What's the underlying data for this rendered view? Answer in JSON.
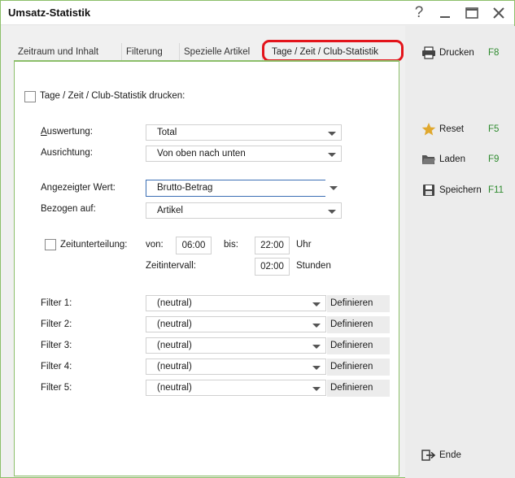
{
  "window": {
    "title": "Umsatz-Statistik"
  },
  "titlebar_buttons": {
    "help": "?"
  },
  "tabs": [
    {
      "label": "Zeitraum und Inhalt"
    },
    {
      "label": "Filterung"
    },
    {
      "label": "Spezielle Artikel"
    },
    {
      "label": "Tage / Zeit / Club-Statistik"
    }
  ],
  "form": {
    "print_checkbox_label": "Tage / Zeit / Club-Statistik drucken:",
    "auswertung": {
      "label": "Auswertung:",
      "value": "Total"
    },
    "ausrichtung": {
      "label": "Ausrichtung:",
      "value": "Von oben nach unten"
    },
    "angezeigter_wert": {
      "label": "Angezeigter Wert:",
      "value": "Brutto-Betrag"
    },
    "bezogen_auf": {
      "label": "Bezogen auf:",
      "value": "Artikel"
    },
    "zeitunterteilung": {
      "label": "Zeitunterteilung:",
      "von_label": "von:",
      "von_value": "06:00",
      "bis_label": "bis:",
      "bis_value": "22:00",
      "unit_hours": "Uhr",
      "intervall_label": "Zeitintervall:",
      "intervall_value": "02:00",
      "unit_intervall": "Stunden"
    },
    "filters": [
      {
        "label": "Filter 1:",
        "value": "(neutral)",
        "button": "Definieren"
      },
      {
        "label": "Filter 2:",
        "value": "(neutral)",
        "button": "Definieren"
      },
      {
        "label": "Filter 3:",
        "value": "(neutral)",
        "button": "Definieren"
      },
      {
        "label": "Filter 4:",
        "value": "(neutral)",
        "button": "Definieren"
      },
      {
        "label": "Filter 5:",
        "value": "(neutral)",
        "button": "Definieren"
      }
    ]
  },
  "actions": {
    "drucken": {
      "label": "Drucken",
      "key": "F8"
    },
    "reset": {
      "label": "Reset",
      "key": "F5"
    },
    "laden": {
      "label": "Laden",
      "key": "F9"
    },
    "speichern": {
      "label": "Speichern",
      "key": "F11"
    },
    "ende": {
      "label": "Ende"
    }
  },
  "colors": {
    "accent_green": "#8cbf6a",
    "key_green": "#2e8b2e",
    "highlight_red": "#e3141b",
    "focus_blue": "#3c6fb5"
  }
}
